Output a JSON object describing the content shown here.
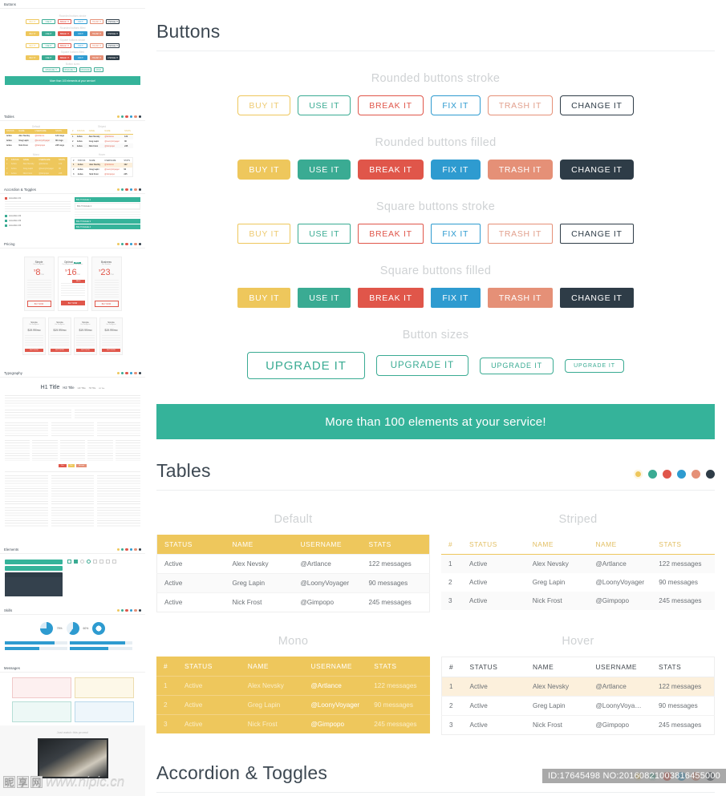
{
  "palette": {
    "yellow": "#eec75c",
    "teal": "#3aab93",
    "red": "#e0564a",
    "blue": "#2e9bd0",
    "salmon": "#e59077",
    "dark": "#2e3c47",
    "banner_teal": "#35b39a",
    "username_red": "#e1604f"
  },
  "sections": {
    "buttons": {
      "title": "Buttons",
      "groups": [
        {
          "label": "Rounded buttons stroke",
          "shape": "rounded",
          "fill": "stroke"
        },
        {
          "label": "Rounded buttons filled",
          "shape": "rounded",
          "fill": "filled"
        },
        {
          "label": "Square buttons stroke",
          "shape": "square",
          "fill": "stroke"
        },
        {
          "label": "Square buttons filled",
          "shape": "square",
          "fill": "filled"
        }
      ],
      "labels": [
        "BUY IT",
        "USE IT",
        "BREAK IT",
        "FIX IT",
        "TRASH IT",
        "CHANGE IT"
      ],
      "colors": [
        "#eec75c",
        "#3aab93",
        "#e0564a",
        "#2e9bd0",
        "#e59077",
        "#2e3c47"
      ],
      "sizes_label": "Button sizes",
      "sizes": [
        {
          "label": "UPGRADE IT",
          "size": "l"
        },
        {
          "label": "UPGRADE IT",
          "size": "m"
        },
        {
          "label": "UPGRADE IT",
          "size": "s"
        },
        {
          "label": "UPGRADE IT",
          "size": "xs"
        }
      ]
    },
    "banner": {
      "text": "More than 100 elements at your service!"
    },
    "tables": {
      "title": "Tables",
      "variants": [
        {
          "caption": "Default",
          "headers": [
            "STATUS",
            "NAME",
            "USERNAME",
            "STATS"
          ],
          "rows": [
            [
              "Active",
              "Alex Nevsky",
              "@Artlance",
              "122 messages"
            ],
            [
              "Active",
              "Greg Lapin",
              "@LoonyVoyager",
              "90 messages"
            ],
            [
              "Active",
              "Nick Frost",
              "@Gimpopo",
              "245 messages"
            ]
          ]
        },
        {
          "caption": "Striped",
          "headers": [
            "#",
            "STATUS",
            "NAME",
            "NAME",
            "STATS"
          ],
          "rows": [
            [
              "1",
              "Active",
              "Alex Nevsky",
              "@Artlance",
              "122 messages"
            ],
            [
              "2",
              "Active",
              "Greg Lapin",
              "@LoonyVoyager",
              "90 messages"
            ],
            [
              "3",
              "Active",
              "Nick Frost",
              "@Gimpopo",
              "245 messages"
            ]
          ]
        },
        {
          "caption": "Mono",
          "headers": [
            "#",
            "STATUS",
            "NAME",
            "USERNAME",
            "STATS"
          ],
          "rows": [
            [
              "1",
              "Active",
              "Alex Nevsky",
              "@Artlance",
              "122 messages"
            ],
            [
              "2",
              "Active",
              "Greg Lapin",
              "@LoonyVoyager",
              "90 messages"
            ],
            [
              "3",
              "Active",
              "Nick Frost",
              "@Gimpopo",
              "245 messages"
            ]
          ]
        },
        {
          "caption": "Hover",
          "headers": [
            "#",
            "STATUS",
            "NAME",
            "USERNAME",
            "STATS"
          ],
          "rows": [
            [
              "1",
              "Active",
              "Alex Nevsky",
              "@Artlance",
              "122 messages"
            ],
            [
              "2",
              "Active",
              "Greg Lapin",
              "@LoonyVoyager",
              "90 messages"
            ],
            [
              "3",
              "Active",
              "Nick Frost",
              "@Gimpopo",
              "245 messages"
            ]
          ]
        }
      ]
    },
    "accordion": {
      "title": "Accordion & Toggles"
    }
  },
  "sidebar": {
    "thumbs": [
      {
        "title": "Buttons"
      },
      {
        "title": "Tables"
      },
      {
        "title": "Accordion & Toggles"
      },
      {
        "title": "Pricing"
      },
      {
        "title": "Typography"
      },
      {
        "title": "Elements"
      },
      {
        "title": "Skills"
      },
      {
        "title": "Messages"
      }
    ],
    "buttons_mini": {
      "rows": [
        "Rounded buttons stroke",
        "Rounded buttons filled",
        "Square buttons stroke",
        "Square buttons filled"
      ],
      "sizes_label": "Button sizes",
      "banner": "More than 100 elements at your service!"
    },
    "pricing": {
      "plans": [
        {
          "name": "Simple",
          "sub": "For Designers",
          "price": "8",
          "per": "/mo"
        },
        {
          "name": "Optimal",
          "sub": "For professional designers",
          "price": "16",
          "per": "/mo",
          "badge": "BEST"
        },
        {
          "name": "Business",
          "sub": "For Studios",
          "price": "23",
          "per": "/mo"
        }
      ],
      "cta": "BUY NOW"
    },
    "typography": {
      "h1": "H1 Title",
      "h2": "H2 Title",
      "h3": "H3 Title",
      "h4": "H4 Title",
      "h5": "H5 Title"
    },
    "skills": {
      "values": [
        "75%",
        "60%"
      ]
    },
    "photo_caption": "Just watch this promo!"
  },
  "watermarks": {
    "id_text": "ID:17645498 NO:20160821003816455000",
    "site": "www.nipic.cn",
    "cjk": [
      "昵",
      "享",
      "网"
    ]
  }
}
